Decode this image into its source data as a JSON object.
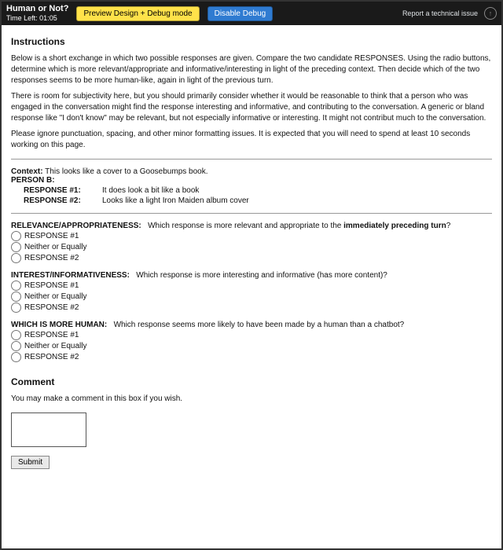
{
  "header": {
    "title": "Human or Not?",
    "timer": "Time Left: 01:05",
    "preview_btn": "Preview Design + Debug mode",
    "disable_btn": "Disable Debug",
    "report_link": "Report a technical issue"
  },
  "instructions": {
    "heading": "Instructions",
    "p1": "Below is a short exchange in which two possible responses are given. Compare the two candidate RESPONSES. Using the radio buttons, determine which is more relevant/appropriate and informative/interesting in light of the preceding context. Then decide which of the two responses seems to be more human-like, again in light of the previous turn.",
    "p2": "There is room for subjectivity here, but you should primarily consider whether it would be reasonable to think that a person who was engaged in the conversation might find the response interesting and informative, and contributing to the conversation. A generic or bland response like \"I don't know\" may be relevant, but not especially informative or interesting. It might not contribut much to the conversation.",
    "p3": "Please ignore punctuation, spacing, and other minor formatting issues. It is expected that you will need to spend at least 10 seconds working on this page."
  },
  "context": {
    "ctx_label": "Context:",
    "ctx_text": "This looks like a cover to a Goosebumps book.",
    "person_label": "PERSON B:",
    "r1_label": "RESPONSE #1:",
    "r1_text": "It does look a bit like a book",
    "r2_label": "RESPONSE #2:",
    "r2_text": "Looks like a light Iron Maiden album cover"
  },
  "q1": {
    "label": "RELEVANCE/APPROPRIATENESS:",
    "prompt_a": "Which response is more relevant and appropriate to the ",
    "prompt_b": "immediately preceding turn",
    "prompt_c": "?",
    "opt1": "RESPONSE #1",
    "opt2": "Neither or Equally",
    "opt3": "RESPONSE #2"
  },
  "q2": {
    "label": "INTEREST/INFORMATIVENESS:",
    "prompt": "Which response is more interesting and informative (has more content)?",
    "opt1": "RESPONSE #1",
    "opt2": "Neither or Equally",
    "opt3": "RESPONSE #2"
  },
  "q3": {
    "label": "WHICH IS MORE HUMAN:",
    "prompt": "Which response seems more likely to have been made by a human than a chatbot?",
    "opt1": "RESPONSE #1",
    "opt2": "Neither or Equally",
    "opt3": "RESPONSE #2"
  },
  "comment": {
    "heading": "Comment",
    "prompt": "You may make a comment in this box if you wish.",
    "submit": "Submit"
  }
}
